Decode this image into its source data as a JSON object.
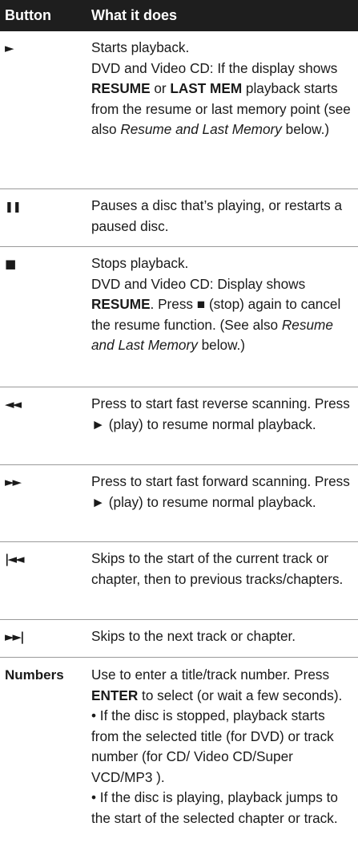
{
  "header": {
    "button": "Button",
    "what": "What it does"
  },
  "rows": [
    {
      "key_icon": "play-icon",
      "glyph": "►",
      "l1": "Starts playback.",
      "l2a": "DVD and Video CD: If the display shows ",
      "l2b": "RESUME",
      "l2c": " or ",
      "l2d": "LAST MEM",
      "l2e": " playback starts from the resume or last memory point (see also ",
      "l2f": "Resume and Last Memory",
      "l2g": " below.)"
    },
    {
      "key_icon": "pause-icon",
      "glyph": "❚❚",
      "l1": "Pauses a disc that’s playing, or restarts a paused disc."
    },
    {
      "key_icon": "stop-icon",
      "glyph": "■",
      "l1": "Stops playback.",
      "l2a": "DVD and Video CD: Display shows ",
      "l2b": "RESUME",
      "l2c": ". Press ■ (stop) again to cancel the resume function. (See also ",
      "l2d": "Resume and Last Memory",
      "l2e": " below.)"
    },
    {
      "key_icon": "fast-reverse-icon",
      "glyph": "◄◄",
      "l1": "Press to start fast reverse scanning. Press ► (play) to resume normal playback."
    },
    {
      "key_icon": "fast-forward-icon",
      "glyph": "►►",
      "l1": "Press to start fast forward scanning. Press ► (play) to resume normal playback."
    },
    {
      "key_icon": "previous-icon",
      "glyph": "|◄◄",
      "l1": "Skips to the start of the current track or chapter, then to previous tracks/chapters."
    },
    {
      "key_icon": "next-icon",
      "glyph": "►►|",
      "l1": "Skips to the next track or chapter."
    },
    {
      "key": "Numbers",
      "l1a": "Use to enter a title/track number. Press ",
      "l1b": "ENTER",
      "l1c": " to select (or wait a few seconds).",
      "l2": "• If the disc is stopped, playback starts from the selected title (for DVD) or track number (for CD/ Video CD/Super VCD/MP3 ).",
      "l3": "• If the disc is playing, playback jumps to the start of the selected chapter or track."
    }
  ]
}
